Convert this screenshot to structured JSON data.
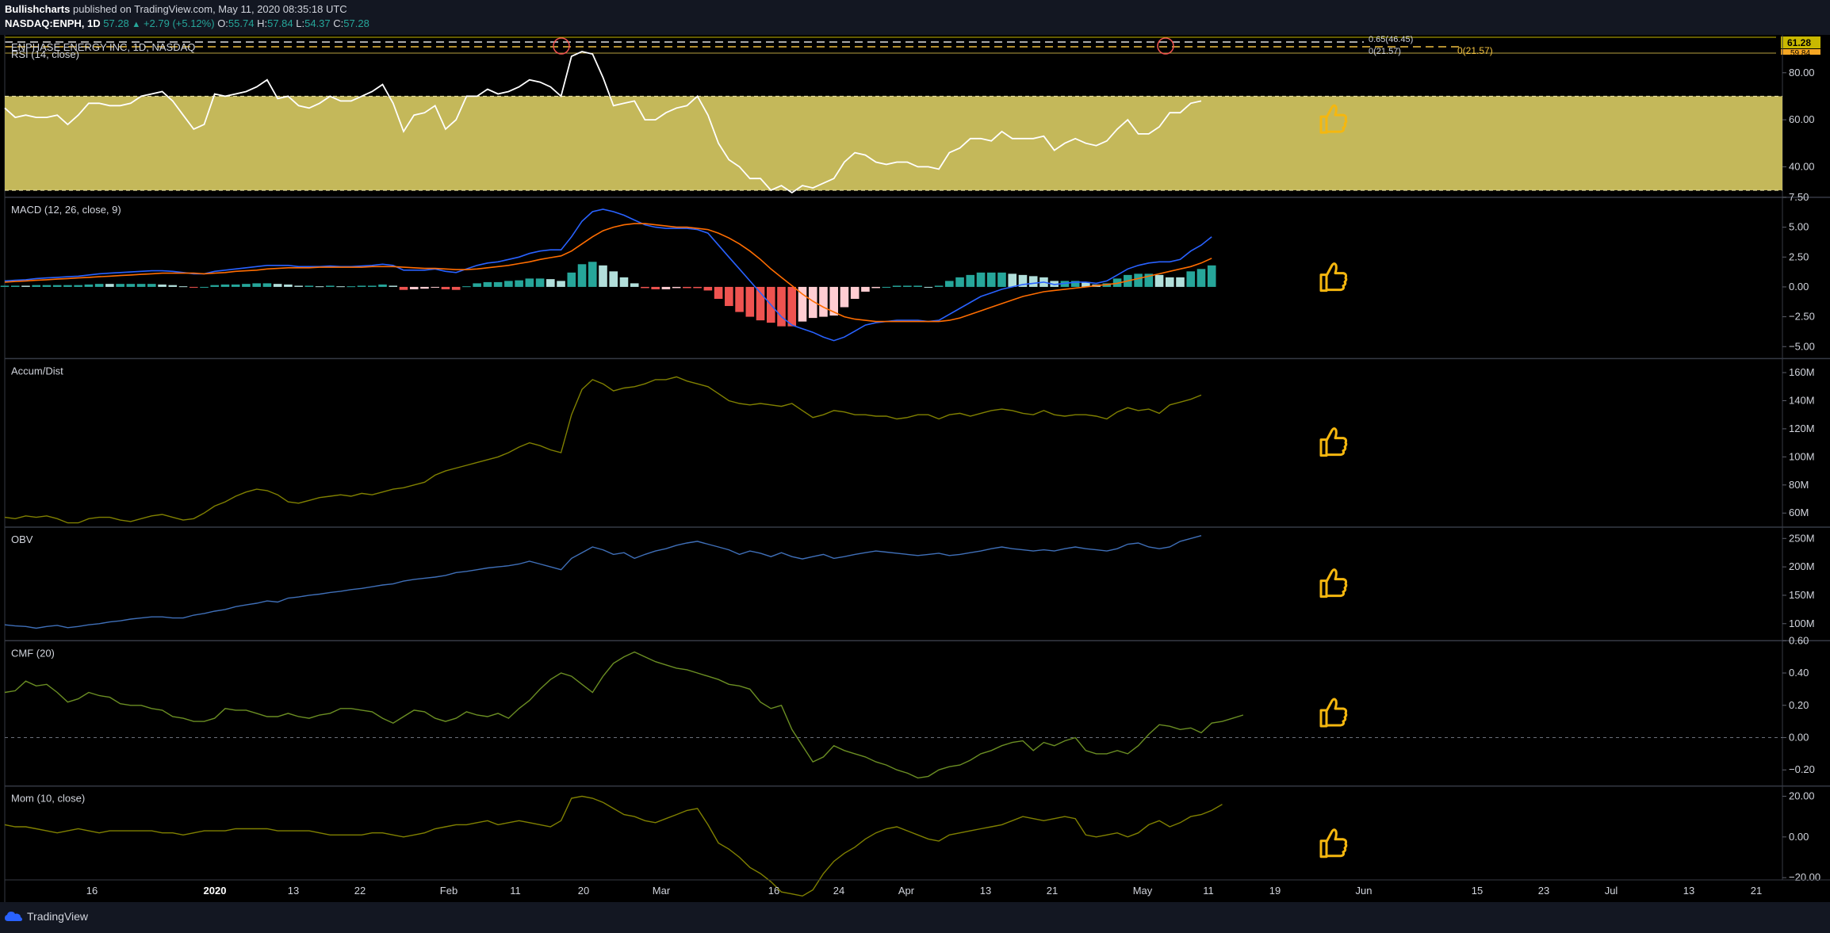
{
  "header": {
    "author": "Bullishcharts",
    "published_text": "published on TradingView.com, May 11, 2020 08:35:18 UTC",
    "symbol": "NASDAQ:ENPH, 1D",
    "last": "57.28",
    "change": "+2.79 (+5.12%)",
    "o_label": "O:",
    "o_value": "55.74",
    "h_label": "H:",
    "h_value": "57.84",
    "l_label": "L:",
    "l_value": "54.37",
    "c_label": "C:",
    "c_value": "57.28"
  },
  "price_pane": {
    "title": "ENPHASE ENERGY INC, 1D, NASDAQ",
    "fib_label_top": "0.65(46.45)",
    "fib_label_low": "0(21.57)",
    "fib_label_right": "0(21.57)",
    "price_badge": "61.28",
    "price_badge_2": "59.84"
  },
  "panes": {
    "rsi": {
      "title": "RSI (14, close)",
      "ticks": [
        "80.00",
        "60.00",
        "40.00"
      ]
    },
    "macd": {
      "title": "MACD (12, 26, close, 9)",
      "ticks": [
        "7.50",
        "5.00",
        "2.50",
        "0.00",
        "−2.50",
        "−5.00"
      ]
    },
    "ad": {
      "title": "Accum/Dist",
      "ticks": [
        "160M",
        "140M",
        "120M",
        "100M",
        "80M",
        "60M"
      ]
    },
    "obv": {
      "title": "OBV",
      "ticks": [
        "250M",
        "200M",
        "150M",
        "100M"
      ]
    },
    "cmf": {
      "title": "CMF (20)",
      "ticks": [
        "0.60",
        "0.40",
        "0.20",
        "0.00",
        "−0.20"
      ]
    },
    "mom": {
      "title": "Mom (10, close)",
      "ticks": [
        "20.00",
        "0.00",
        "−20.00"
      ]
    }
  },
  "x_axis": {
    "labels": [
      "16",
      "2020",
      "13",
      "22",
      "Feb",
      "11",
      "20",
      "Mar",
      "16",
      "24",
      "Apr",
      "13",
      "21",
      "May",
      "11",
      "19",
      "Jun",
      "15",
      "23",
      "Jul",
      "13",
      "21"
    ],
    "bold": [
      "2020"
    ]
  },
  "footer": {
    "brand": "TradingView"
  },
  "colors": {
    "rsi_band": "#c4b85a",
    "thumb": "#f5b70f",
    "macd_line": "#2962ff",
    "signal_line": "#ff6d00",
    "hist_up_strong": "#26a69a",
    "hist_up_weak": "#b2dfdb",
    "hist_down_strong": "#ef5350",
    "hist_down_weak": "#ffcdd2",
    "olive": "#808000",
    "obv_blue": "#3f6fb8"
  },
  "chart_data": [
    {
      "type": "line",
      "name": "RSI (14, close)",
      "ylim": [
        27,
        93
      ],
      "band": [
        30,
        70
      ],
      "values": [
        65,
        61,
        62,
        61,
        61,
        62,
        58,
        62,
        67,
        67,
        66,
        66,
        67,
        70,
        71,
        72,
        68,
        62,
        56,
        58,
        71,
        70,
        71,
        72,
        74,
        77,
        69,
        70,
        66,
        65,
        67,
        70,
        68,
        68,
        70,
        72,
        75,
        67,
        55,
        62,
        63,
        66,
        56,
        60,
        70,
        70,
        73,
        71,
        72,
        74,
        77,
        76,
        74,
        70,
        87,
        89,
        88,
        78,
        66,
        67,
        68,
        60,
        60,
        63,
        65,
        66,
        70,
        62,
        50,
        43,
        40,
        35,
        35,
        30,
        32,
        29,
        32,
        31,
        33,
        35,
        42,
        46,
        45,
        42,
        41,
        42,
        42,
        40,
        40,
        39,
        46,
        48,
        52,
        52,
        51,
        55,
        52,
        52,
        52,
        53,
        47,
        50,
        52,
        50,
        49,
        51,
        56,
        60,
        54,
        54,
        57,
        63,
        63,
        67,
        68
      ],
      "thumb": true
    },
    {
      "type": "bar+line",
      "name": "MACD (12, 26, close, 9)",
      "ylim": [
        -6,
        7.5
      ],
      "macd": [
        0.5,
        0.55,
        0.6,
        0.7,
        0.75,
        0.8,
        0.85,
        0.9,
        1.0,
        1.1,
        1.15,
        1.2,
        1.25,
        1.3,
        1.35,
        1.35,
        1.3,
        1.2,
        1.1,
        1.1,
        1.3,
        1.4,
        1.5,
        1.6,
        1.7,
        1.8,
        1.8,
        1.8,
        1.7,
        1.7,
        1.7,
        1.75,
        1.7,
        1.7,
        1.75,
        1.8,
        1.9,
        1.8,
        1.4,
        1.4,
        1.4,
        1.5,
        1.3,
        1.2,
        1.5,
        1.8,
        2.0,
        2.1,
        2.3,
        2.5,
        2.8,
        3.0,
        3.1,
        3.1,
        4.2,
        5.5,
        6.3,
        6.5,
        6.3,
        6.0,
        5.6,
        5.2,
        5.0,
        4.9,
        4.9,
        4.9,
        4.8,
        4.5,
        3.5,
        2.5,
        1.5,
        0.5,
        -0.5,
        -1.5,
        -2.5,
        -3.2,
        -3.5,
        -3.8,
        -4.2,
        -4.5,
        -4.2,
        -3.7,
        -3.2,
        -3.0,
        -2.9,
        -2.8,
        -2.8,
        -2.8,
        -2.9,
        -2.8,
        -2.3,
        -1.8,
        -1.3,
        -0.8,
        -0.5,
        -0.2,
        0.0,
        0.2,
        0.3,
        0.4,
        0.2,
        0.3,
        0.4,
        0.4,
        0.3,
        0.5,
        1.0,
        1.5,
        1.8,
        2.0,
        2.1,
        2.1,
        2.3,
        3.0,
        3.5,
        4.2
      ],
      "signal": [
        0.4,
        0.45,
        0.5,
        0.55,
        0.6,
        0.65,
        0.7,
        0.75,
        0.8,
        0.85,
        0.9,
        0.95,
        1.0,
        1.05,
        1.1,
        1.15,
        1.15,
        1.15,
        1.15,
        1.1,
        1.15,
        1.2,
        1.3,
        1.35,
        1.4,
        1.5,
        1.55,
        1.6,
        1.6,
        1.6,
        1.65,
        1.65,
        1.65,
        1.65,
        1.65,
        1.7,
        1.7,
        1.7,
        1.65,
        1.6,
        1.55,
        1.55,
        1.5,
        1.45,
        1.45,
        1.5,
        1.6,
        1.7,
        1.8,
        1.95,
        2.1,
        2.3,
        2.45,
        2.6,
        3.0,
        3.6,
        4.2,
        4.7,
        5.0,
        5.2,
        5.3,
        5.3,
        5.2,
        5.1,
        5.0,
        5.0,
        4.9,
        4.8,
        4.5,
        4.1,
        3.6,
        3.0,
        2.3,
        1.5,
        0.8,
        0.1,
        -0.6,
        -1.2,
        -1.7,
        -2.1,
        -2.5,
        -2.7,
        -2.8,
        -2.9,
        -2.9,
        -2.9,
        -2.9,
        -2.9,
        -2.9,
        -2.9,
        -2.8,
        -2.6,
        -2.3,
        -2.0,
        -1.7,
        -1.4,
        -1.1,
        -0.8,
        -0.6,
        -0.4,
        -0.3,
        -0.2,
        -0.1,
        0.0,
        0.1,
        0.2,
        0.3,
        0.5,
        0.7,
        0.9,
        1.1,
        1.3,
        1.5,
        1.7,
        2.0,
        2.4
      ],
      "thumb": true
    },
    {
      "type": "line",
      "name": "Accum/Dist",
      "ylim": [
        50000000,
        170000000
      ],
      "values": [
        57,
        56,
        58,
        57,
        58,
        56,
        53,
        53,
        56,
        57,
        57,
        55,
        54,
        56,
        58,
        59,
        57,
        55,
        56,
        60,
        65,
        68,
        72,
        75,
        77,
        76,
        73,
        68,
        67,
        69,
        71,
        72,
        73,
        72,
        74,
        73,
        75,
        77,
        78,
        80,
        82,
        87,
        90,
        92,
        94,
        96,
        98,
        100,
        103,
        107,
        110,
        108,
        105,
        103,
        130,
        148,
        155,
        152,
        147,
        149,
        150,
        152,
        155,
        155,
        157,
        154,
        152,
        150,
        145,
        140,
        138,
        137,
        138,
        137,
        136,
        138,
        133,
        128,
        130,
        133,
        132,
        130,
        130,
        129,
        129,
        127,
        128,
        130,
        130,
        127,
        130,
        131,
        129,
        131,
        133,
        134,
        133,
        131,
        130,
        133,
        130,
        129,
        130,
        130,
        129,
        127,
        132,
        135,
        133,
        134,
        131,
        137,
        139,
        141,
        144
      ],
      "thumb": true
    },
    {
      "type": "line",
      "name": "OBV",
      "ylim": [
        70000000,
        270000000
      ],
      "values": [
        98,
        96,
        95,
        92,
        95,
        97,
        93,
        95,
        98,
        100,
        103,
        105,
        108,
        110,
        112,
        112,
        110,
        110,
        115,
        118,
        122,
        125,
        130,
        133,
        136,
        140,
        138,
        145,
        147,
        150,
        152,
        155,
        157,
        160,
        162,
        165,
        168,
        170,
        175,
        178,
        180,
        182,
        185,
        190,
        192,
        195,
        198,
        200,
        202,
        205,
        210,
        205,
        200,
        195,
        215,
        225,
        235,
        230,
        222,
        225,
        215,
        222,
        228,
        232,
        238,
        242,
        245,
        240,
        235,
        230,
        222,
        228,
        224,
        218,
        225,
        218,
        214,
        218,
        222,
        215,
        218,
        222,
        225,
        228,
        226,
        224,
        222,
        220,
        222,
        224,
        220,
        222,
        225,
        228,
        232,
        235,
        232,
        230,
        228,
        230,
        228,
        232,
        235,
        232,
        230,
        228,
        232,
        240,
        242,
        235,
        232,
        235,
        245,
        250,
        255
      ],
      "thumb": true
    },
    {
      "type": "line",
      "name": "CMF (20)",
      "ylim": [
        -0.3,
        0.6
      ],
      "values": [
        0.28,
        0.29,
        0.35,
        0.32,
        0.33,
        0.28,
        0.22,
        0.24,
        0.28,
        0.26,
        0.25,
        0.21,
        0.2,
        0.2,
        0.18,
        0.17,
        0.13,
        0.12,
        0.1,
        0.1,
        0.12,
        0.18,
        0.17,
        0.17,
        0.15,
        0.13,
        0.13,
        0.15,
        0.13,
        0.12,
        0.14,
        0.15,
        0.18,
        0.18,
        0.17,
        0.16,
        0.12,
        0.09,
        0.13,
        0.17,
        0.16,
        0.12,
        0.1,
        0.12,
        0.16,
        0.14,
        0.13,
        0.15,
        0.12,
        0.18,
        0.23,
        0.3,
        0.36,
        0.4,
        0.38,
        0.33,
        0.28,
        0.38,
        0.46,
        0.5,
        0.53,
        0.5,
        0.47,
        0.45,
        0.43,
        0.42,
        0.4,
        0.38,
        0.36,
        0.33,
        0.32,
        0.3,
        0.22,
        0.18,
        0.2,
        0.05,
        -0.05,
        -0.15,
        -0.12,
        -0.05,
        -0.08,
        -0.1,
        -0.12,
        -0.15,
        -0.17,
        -0.2,
        -0.22,
        -0.25,
        -0.24,
        -0.2,
        -0.18,
        -0.17,
        -0.14,
        -0.1,
        -0.08,
        -0.05,
        -0.03,
        -0.02,
        -0.08,
        -0.03,
        -0.05,
        -0.02,
        0.0,
        -0.08,
        -0.1,
        -0.1,
        -0.08,
        -0.1,
        -0.05,
        0.02,
        0.08,
        0.07,
        0.05,
        0.06,
        0.03,
        0.09,
        0.1,
        0.12,
        0.14
      ],
      "thumb": true
    },
    {
      "type": "line",
      "name": "Mom (10, close)",
      "ylim": [
        -32,
        25
      ],
      "values": [
        6,
        5,
        5,
        4,
        3,
        2,
        3,
        4,
        3,
        2,
        3,
        3,
        3,
        3,
        3,
        2,
        2,
        1,
        2,
        3,
        3,
        3,
        4,
        4,
        4,
        4,
        3,
        3,
        3,
        3,
        2,
        1,
        1,
        1,
        1,
        2,
        2,
        1,
        0,
        1,
        2,
        4,
        5,
        6,
        6,
        7,
        8,
        6,
        7,
        8,
        7,
        6,
        5,
        8,
        19,
        20,
        19,
        17,
        14,
        11,
        10,
        8,
        7,
        9,
        11,
        13,
        14,
        6,
        -3,
        -6,
        -10,
        -15,
        -18,
        -22,
        -27,
        -28,
        -29,
        -26,
        -18,
        -12,
        -8,
        -5,
        -1,
        2,
        4,
        5,
        3,
        1,
        -1,
        -2,
        1,
        2,
        3,
        4,
        5,
        6,
        8,
        10,
        9,
        8,
        9,
        10,
        9,
        1,
        0,
        1,
        2,
        0,
        2,
        6,
        8,
        5,
        7,
        10,
        11,
        13,
        16
      ],
      "thumb": true
    }
  ]
}
